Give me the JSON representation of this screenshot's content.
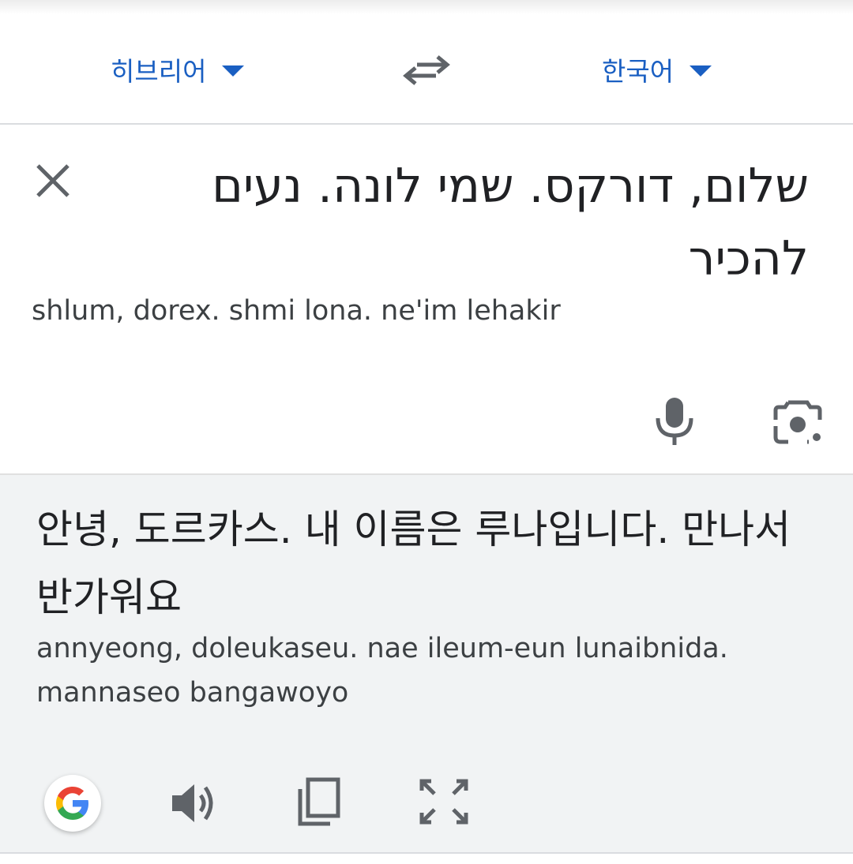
{
  "languages": {
    "source": "히브리어",
    "target": "한국어"
  },
  "input": {
    "text": "שלום, דורקס. שמי לונה. נעים להכיר",
    "transliteration": "shlum, dorex. shmi lona. ne'im lehakir"
  },
  "output": {
    "text": "안녕, 도르카스. 내 이름은 루나입니다. 만나서 반가워요",
    "transliteration": "annyeong, doleukaseu. nae ileum-eun lunaibnida. mannaseo bangawoyo"
  },
  "icons": {
    "swap": "swap-arrows-icon",
    "clear": "close-icon",
    "mic": "microphone-icon",
    "camera": "lens-camera-icon",
    "google": "google-g-icon",
    "speaker": "speaker-icon",
    "copy": "copy-icon",
    "fullscreen": "fullscreen-icon"
  },
  "colors": {
    "accent": "#1a5fc2",
    "icon": "#5f6368",
    "output_bg": "#f1f3f4"
  }
}
